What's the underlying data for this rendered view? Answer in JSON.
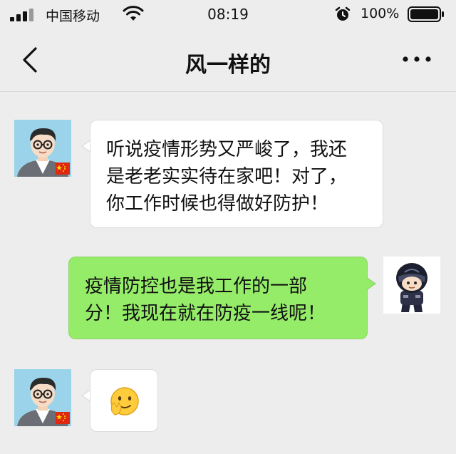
{
  "status_bar": {
    "carrier": "中国移动",
    "time": "08:19",
    "battery_percent": "100%",
    "signal_bars": 4,
    "icons": [
      "signal-icon",
      "wifi-icon",
      "alarm-icon",
      "battery-icon"
    ]
  },
  "header": {
    "title": "风一样的",
    "back_icon": "chevron-left-icon",
    "more_icon": "more-dots-icon"
  },
  "messages": [
    {
      "from": "contact",
      "lines": [
        "听说疫情形势又严峻了，我还",
        "是老老实实待在家吧！对了，",
        "你工作时候也得做好防护！"
      ]
    },
    {
      "from": "me",
      "lines": [
        "疫情防控也是我工作的一部",
        "分！我现在就在防疫一线呢！"
      ]
    },
    {
      "from": "contact",
      "emoji": "🤗"
    }
  ],
  "colors": {
    "background": "#ededed",
    "outgoing_bubble": "#95ec69",
    "incoming_bubble": "#ffffff"
  }
}
